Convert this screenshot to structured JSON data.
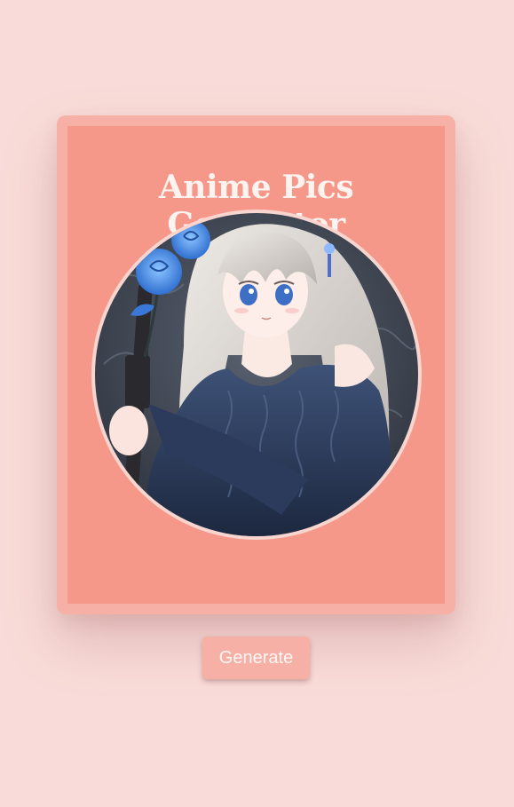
{
  "app": {
    "title": "Anime Pics Generator"
  },
  "image": {
    "alt": "Anime girl with long silver hair, blue eyes, holding a bouquet of blue roses, wearing a navy off-shoulder sweater",
    "icon": "anime-portrait"
  },
  "actions": {
    "generate_label": "Generate"
  },
  "colors": {
    "background": "#f9dcd9",
    "card_outer": "#f6b0a6",
    "card_inner": "#f59789",
    "title_text": "#fff3f0",
    "button_bg": "#f6b0a6",
    "button_text": "#fff7f5"
  }
}
